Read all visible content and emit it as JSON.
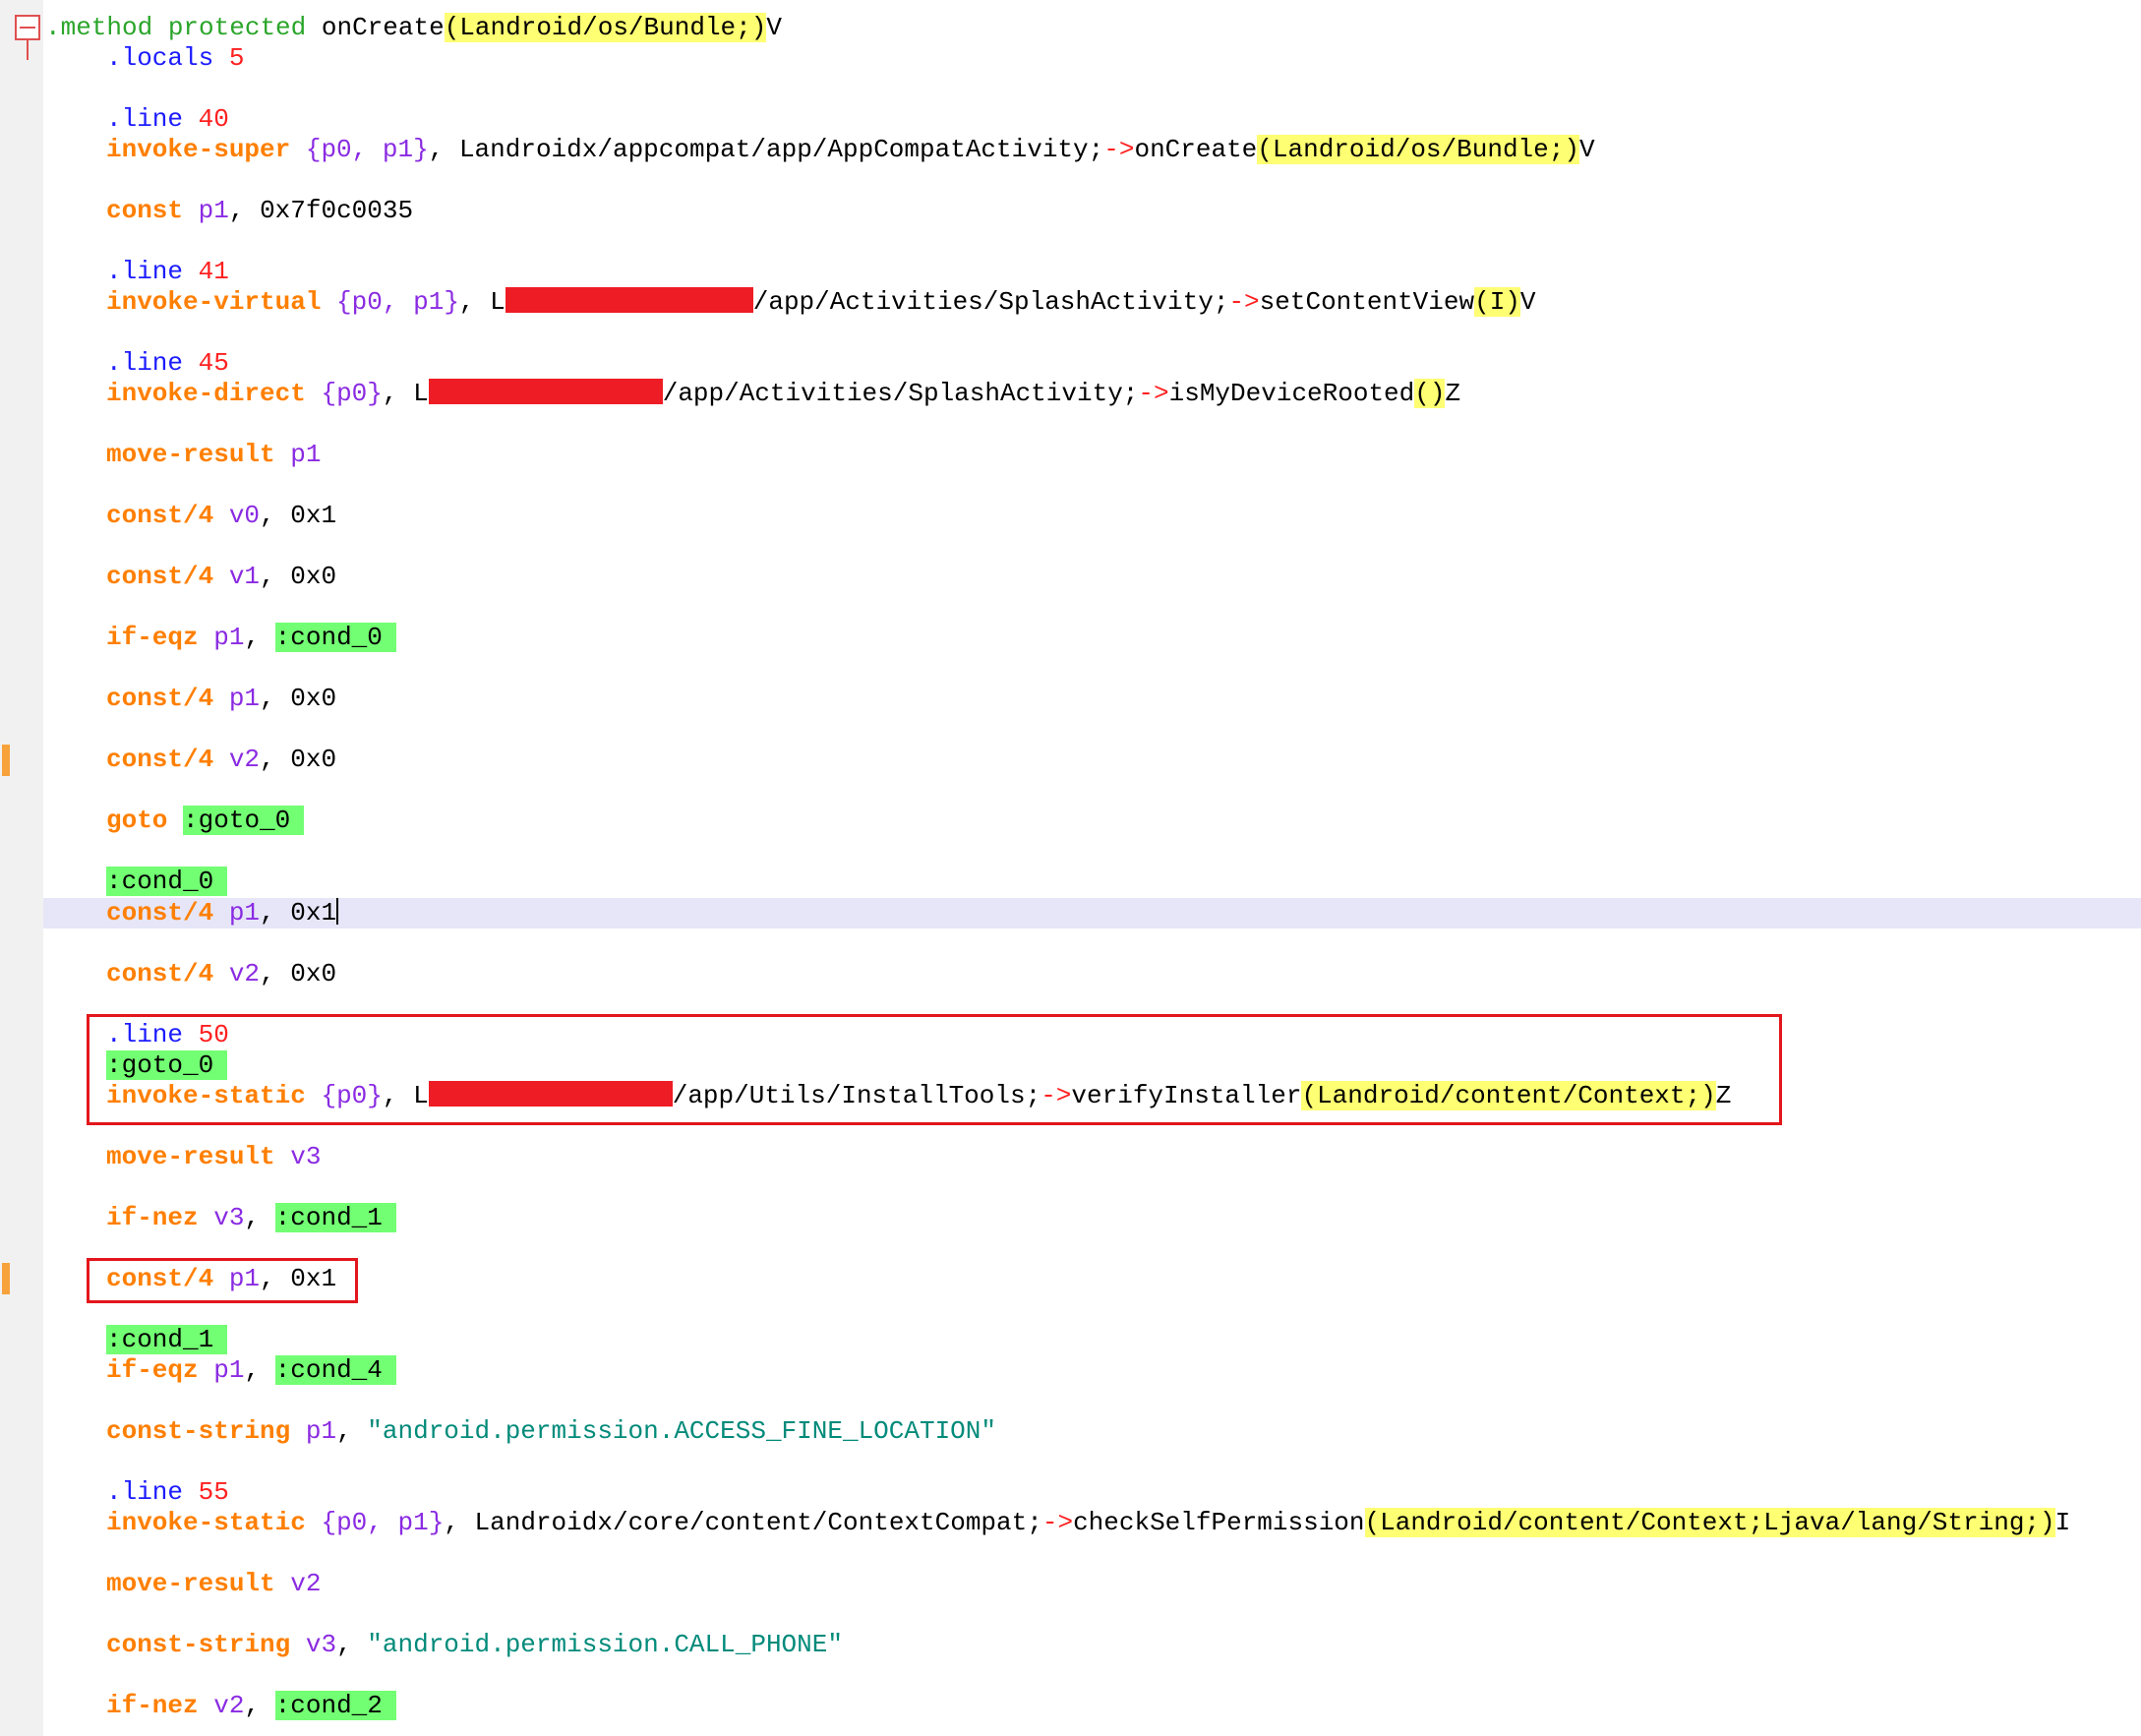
{
  "lines": {
    "l1": {
      "prefix": ".method",
      "mod": "protected",
      "name": "onCreate",
      "sig": "(Landroid/os/Bundle;)",
      "ret": "V"
    },
    "l2": {
      "directive": ".locals",
      "num": "5"
    },
    "l3": {
      "directive": ".line",
      "num": "40"
    },
    "l4": {
      "op": "invoke-super",
      "regs_open": "{",
      "r1": "p0",
      "sep": ", ",
      "r2": "p1",
      "regs_close": "}",
      "comma": ", ",
      "cls": "Landroidx/appcompat/app/AppCompatActivity;",
      "arrow": "->",
      "method": "onCreate",
      "sig": "(Landroid/os/Bundle;)",
      "ret": "V"
    },
    "l5": {
      "op": "const",
      "reg": "p1",
      "val": "0x7f0c0035"
    },
    "l6": {
      "directive": ".line",
      "num": "41"
    },
    "l7": {
      "op": "invoke-virtual",
      "r1": "p0",
      "r2": "p1",
      "cls_start": "L",
      "cls_end": "/app/Activities/SplashActivity;",
      "arrow": "->",
      "method": "setContentView",
      "sig": "(I)",
      "ret": "V"
    },
    "l8": {
      "directive": ".line",
      "num": "45"
    },
    "l9": {
      "op": "invoke-direct",
      "r1": "p0",
      "cls_start": "L",
      "cls_end": "/app/Activities/SplashActivity;",
      "arrow": "->",
      "method": "isMyDeviceRooted",
      "sig": "()",
      "ret": "Z"
    },
    "l10": {
      "op": "move-result",
      "reg": "p1"
    },
    "l11": {
      "op": "const/4",
      "reg": "v0",
      "val": "0x1"
    },
    "l12": {
      "op": "const/4",
      "reg": "v1",
      "val": "0x0"
    },
    "l13": {
      "op": "if-eqz",
      "reg": "p1",
      "label": ":cond_0"
    },
    "l14": {
      "op": "const/4",
      "reg": "p1",
      "val": "0x0"
    },
    "l15": {
      "op": "const/4",
      "reg": "v2",
      "val": "0x0"
    },
    "l16": {
      "op": "goto",
      "label": ":goto_0"
    },
    "l17": {
      "label": ":cond_0"
    },
    "l18": {
      "op": "const/4",
      "reg": "p1",
      "val": "0x1"
    },
    "l19": {
      "op": "const/4",
      "reg": "v2",
      "val": "0x0"
    },
    "l20": {
      "directive": ".line",
      "num": "50"
    },
    "l21": {
      "label": ":goto_0"
    },
    "l22": {
      "op": "invoke-static",
      "r1": "p0",
      "cls_start": "L",
      "cls_end": "/app/Utils/InstallTools;",
      "arrow": "->",
      "method": "verifyInstaller",
      "sig": "(Landroid/content/Context;)",
      "ret": "Z"
    },
    "l23": {
      "op": "move-result",
      "reg": "v3"
    },
    "l24": {
      "op": "if-nez",
      "reg": "v3",
      "label": ":cond_1"
    },
    "l25": {
      "op": "const/4",
      "reg": "p1",
      "val": "0x1"
    },
    "l26": {
      "label": ":cond_1"
    },
    "l27": {
      "op": "if-eqz",
      "reg": "p1",
      "label": ":cond_4"
    },
    "l28": {
      "op": "const-string",
      "reg": "p1",
      "str": "\"android.permission.ACCESS_FINE_LOCATION\""
    },
    "l29": {
      "directive": ".line",
      "num": "55"
    },
    "l30": {
      "op": "invoke-static",
      "r1": "p0",
      "r2": "p1",
      "cls": "Landroidx/core/content/ContextCompat;",
      "arrow": "->",
      "method": "checkSelfPermission",
      "sig": "(Landroid/content/Context;Ljava/lang/String;)",
      "ret": "I"
    },
    "l31": {
      "op": "move-result",
      "reg": "v2"
    },
    "l32": {
      "op": "const-string",
      "reg": "v3",
      "str": "\"android.permission.CALL_PHONE\""
    },
    "l33": {
      "op": "if-nez",
      "reg": "v2",
      "label": ":cond_2"
    }
  },
  "colors": {
    "opcode": "#ff7f00",
    "directive": "#1c1cff",
    "number": "#ff2020",
    "register": "#8a2be2",
    "string": "#008a7a",
    "label_bg": "#73ff73",
    "signature_bg": "#ffff73",
    "annotation_box": "#e3161c",
    "redaction": "#ee1c24"
  }
}
